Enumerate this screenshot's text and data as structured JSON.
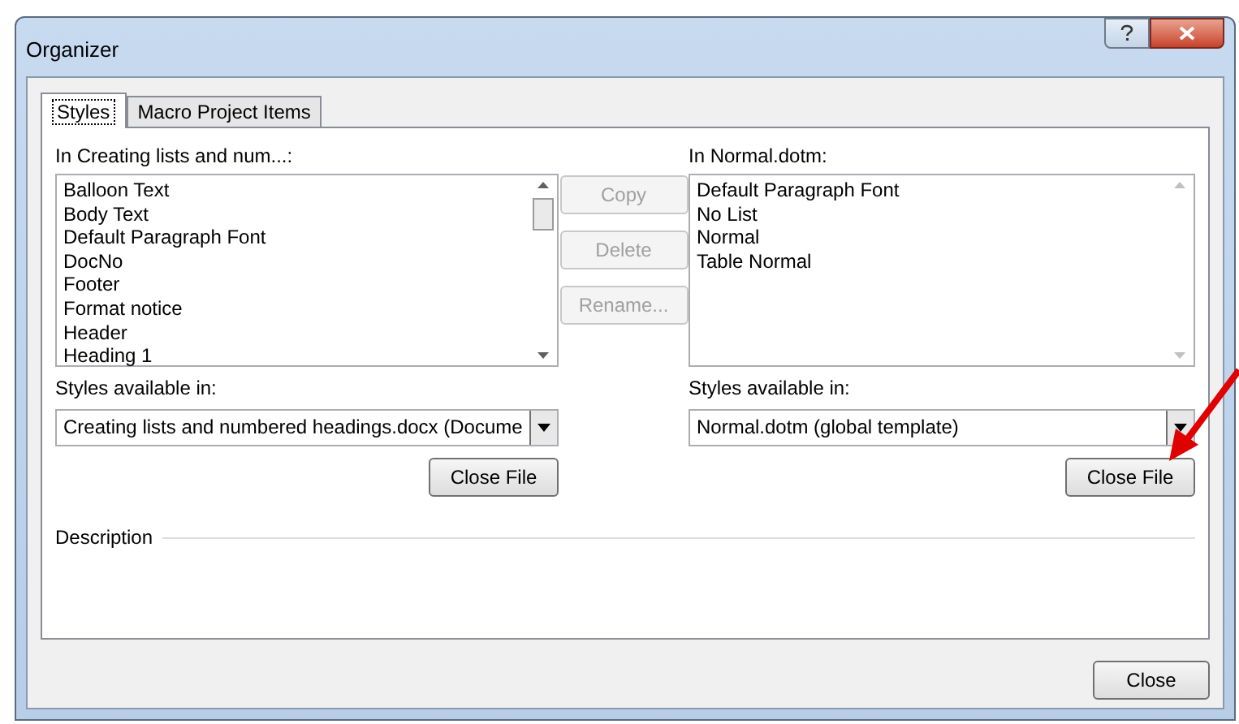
{
  "window": {
    "title": "Organizer"
  },
  "tabs": [
    {
      "label": "Styles",
      "selected": true
    },
    {
      "label": "Macro Project Items",
      "selected": false
    }
  ],
  "left": {
    "label": "In Creating lists and num...:",
    "items": [
      "Balloon Text",
      "Body Text",
      "Default Paragraph Font",
      "DocNo",
      "Footer",
      "Format notice",
      "Header",
      "Heading 1"
    ],
    "available_label": "Styles available in:",
    "available_value": "Creating lists and numbered headings.docx (Docume",
    "close_file": "Close File"
  },
  "actions": [
    {
      "label": "Copy",
      "disabled": true
    },
    {
      "label": "Delete",
      "disabled": true
    },
    {
      "label": "Rename...",
      "disabled": true
    }
  ],
  "right": {
    "label": "In Normal.dotm:",
    "items": [
      "Default Paragraph Font",
      "No List",
      "Normal",
      "Table Normal"
    ],
    "available_label": "Styles available in:",
    "available_value": "Normal.dotm (global template)",
    "close_file": "Close File"
  },
  "description_label": "Description",
  "close_button": "Close"
}
